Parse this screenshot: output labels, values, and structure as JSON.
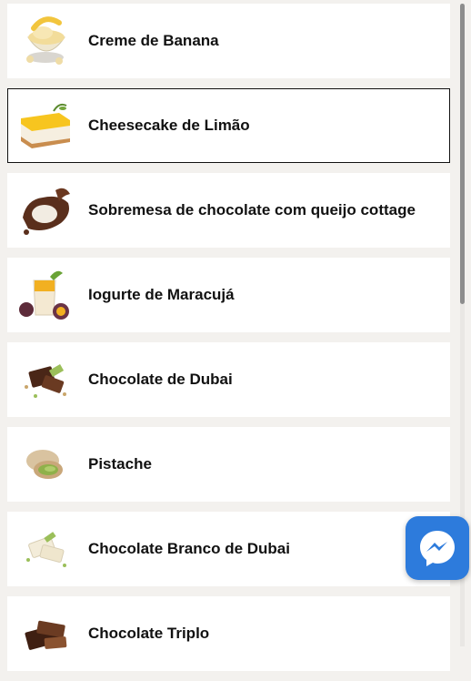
{
  "list": {
    "items": [
      {
        "label": "Creme de Banana",
        "icon": "banana-cream-icon"
      },
      {
        "label": "Cheesecake de Limão",
        "icon": "lemon-cheesecake-icon"
      },
      {
        "label": "Sobremesa de chocolate com queijo cottage",
        "icon": "chocolate-cottage-icon"
      },
      {
        "label": "Iogurte de Maracujá",
        "icon": "passionfruit-yogurt-icon"
      },
      {
        "label": "Chocolate de Dubai",
        "icon": "dubai-chocolate-icon"
      },
      {
        "label": "Pistache",
        "icon": "pistachio-icon"
      },
      {
        "label": "Chocolate Branco de Dubai",
        "icon": "white-dubai-chocolate-icon"
      },
      {
        "label": "Chocolate Triplo",
        "icon": "triple-chocolate-icon"
      }
    ]
  },
  "chat": {
    "icon": "messenger-icon",
    "color": "#2d7bdc"
  },
  "colors": {
    "background": "#f3f1ee",
    "card": "#ffffff",
    "selected_border": "#111111"
  }
}
